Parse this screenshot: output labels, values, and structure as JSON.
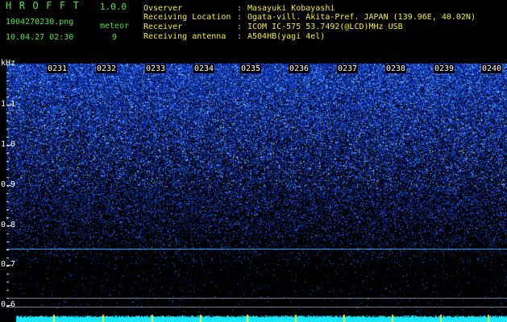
{
  "header": {
    "app_title": "HROFFT",
    "app_version": "1.0.0",
    "filename": "1004270230.png",
    "datetime": "10.04.27 02:30",
    "event_label": "meteor",
    "event_count": "9"
  },
  "info": [
    {
      "label": "Ovserver",
      "value": "Masayuki Kobayashi"
    },
    {
      "label": "Receiving Location",
      "value": "Ogata-vill. Akita-Pref. JAPAN (139.96E, 40.02N)"
    },
    {
      "label": "Receiver",
      "value": "ICOM IC-575 53.7492(@LCD)MHz USB"
    },
    {
      "label": "Receiving antenna",
      "value": "A504HB(yagi 4el)"
    }
  ],
  "info_separator": ":",
  "spectrogram": {
    "y_unit": "kHz",
    "y_ticks": [
      "1.1",
      "1.0",
      "0.9",
      "0.8",
      "0.7",
      "0.6"
    ],
    "time_ticks": [
      "0231",
      "0232",
      "0233",
      "0234",
      "0235",
      "0236",
      "0237",
      "0238",
      "0239",
      "0240"
    ],
    "colors": {
      "background": "#000000",
      "noise_low": "#0a1a8a",
      "noise_high": "#6fb8ff",
      "carrier_line": "#4fa8ff",
      "reference_line": "#8a8aa0",
      "power_bar": "#1ee6ff",
      "minute_marker": "#f2ee3a"
    }
  }
}
